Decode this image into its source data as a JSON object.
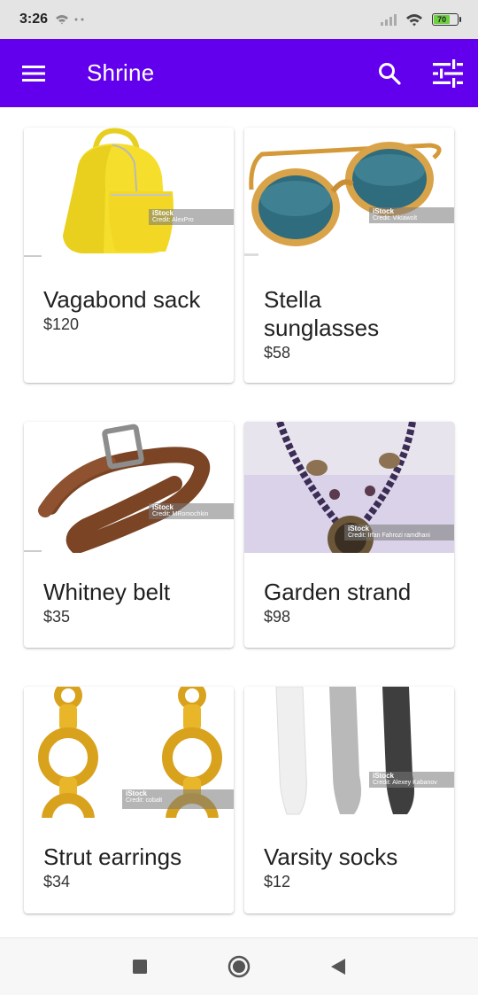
{
  "status": {
    "time": "3:26",
    "battery": "70"
  },
  "app_bar": {
    "title": "Shrine",
    "brand_color": "#6200ee"
  },
  "watermark_brand": "iStock",
  "products": [
    {
      "name": "Vagabond sack",
      "price": "$120",
      "image": "yellow-backpack",
      "credit": "Credit: AlexPro"
    },
    {
      "name": "Stella sunglasses",
      "price": "$58",
      "image": "sunglasses",
      "credit": "Credit: Vikiawolt"
    },
    {
      "name": "Whitney belt",
      "price": "$35",
      "image": "brown-belt",
      "credit": "Credit: MRomochkin"
    },
    {
      "name": "Garden strand",
      "price": "$98",
      "image": "bead-necklace",
      "credit": "Credit: Irfan Fahrozi ramdhani"
    },
    {
      "name": "Strut earrings",
      "price": "$34",
      "image": "gold-earrings",
      "credit": "Credit: cobalt"
    },
    {
      "name": "Varsity socks",
      "price": "$12",
      "image": "socks",
      "credit": "Credit: Alexey Kabanov"
    }
  ]
}
